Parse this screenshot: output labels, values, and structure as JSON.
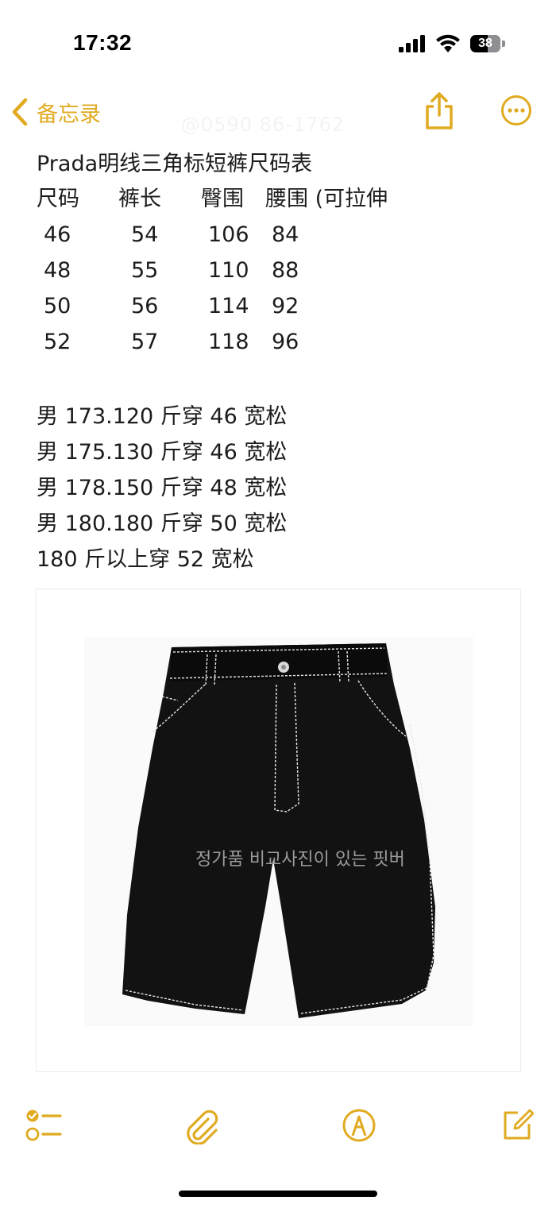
{
  "status_bar": {
    "time": "17:32",
    "battery": "38",
    "icons": [
      "cellular-signal-icon",
      "wifi-icon",
      "battery-icon"
    ]
  },
  "nav": {
    "back_label": "备忘录",
    "faded_title": "@0590 86-1762",
    "icons": [
      "chevron-left-icon",
      "share-icon",
      "more-icon"
    ]
  },
  "note": {
    "title": "Prada明线三角标短裤尺码表",
    "table": {
      "headers": [
        "尺码",
        "裤长",
        "臀围",
        "腰围 (可拉伸"
      ],
      "rows": [
        [
          "46",
          "54",
          "106",
          "84"
        ],
        [
          "48",
          "55",
          "110",
          "88"
        ],
        [
          "50",
          "56",
          "114",
          "92"
        ],
        [
          "52",
          "57",
          "118",
          "96"
        ]
      ]
    },
    "recommendations": [
      "男 173.120 斤穿 46 宽松",
      "男 175.130 斤穿 46 宽松",
      "男 178.150 斤穿 48 宽松",
      "男 180.180 斤穿 50 宽松",
      "180 斤以上穿 52 宽松"
    ],
    "image": {
      "watermark": "정가품 비교사진이 있는 핏버"
    }
  },
  "toolbar": {
    "icons": [
      "checklist-icon",
      "paperclip-icon",
      "markup-pen-icon",
      "compose-icon"
    ]
  },
  "colors": {
    "accent": "#e0ab21",
    "text": "#1c1c1e",
    "shorts": "#111111",
    "stitching": "#e8e8e8"
  }
}
